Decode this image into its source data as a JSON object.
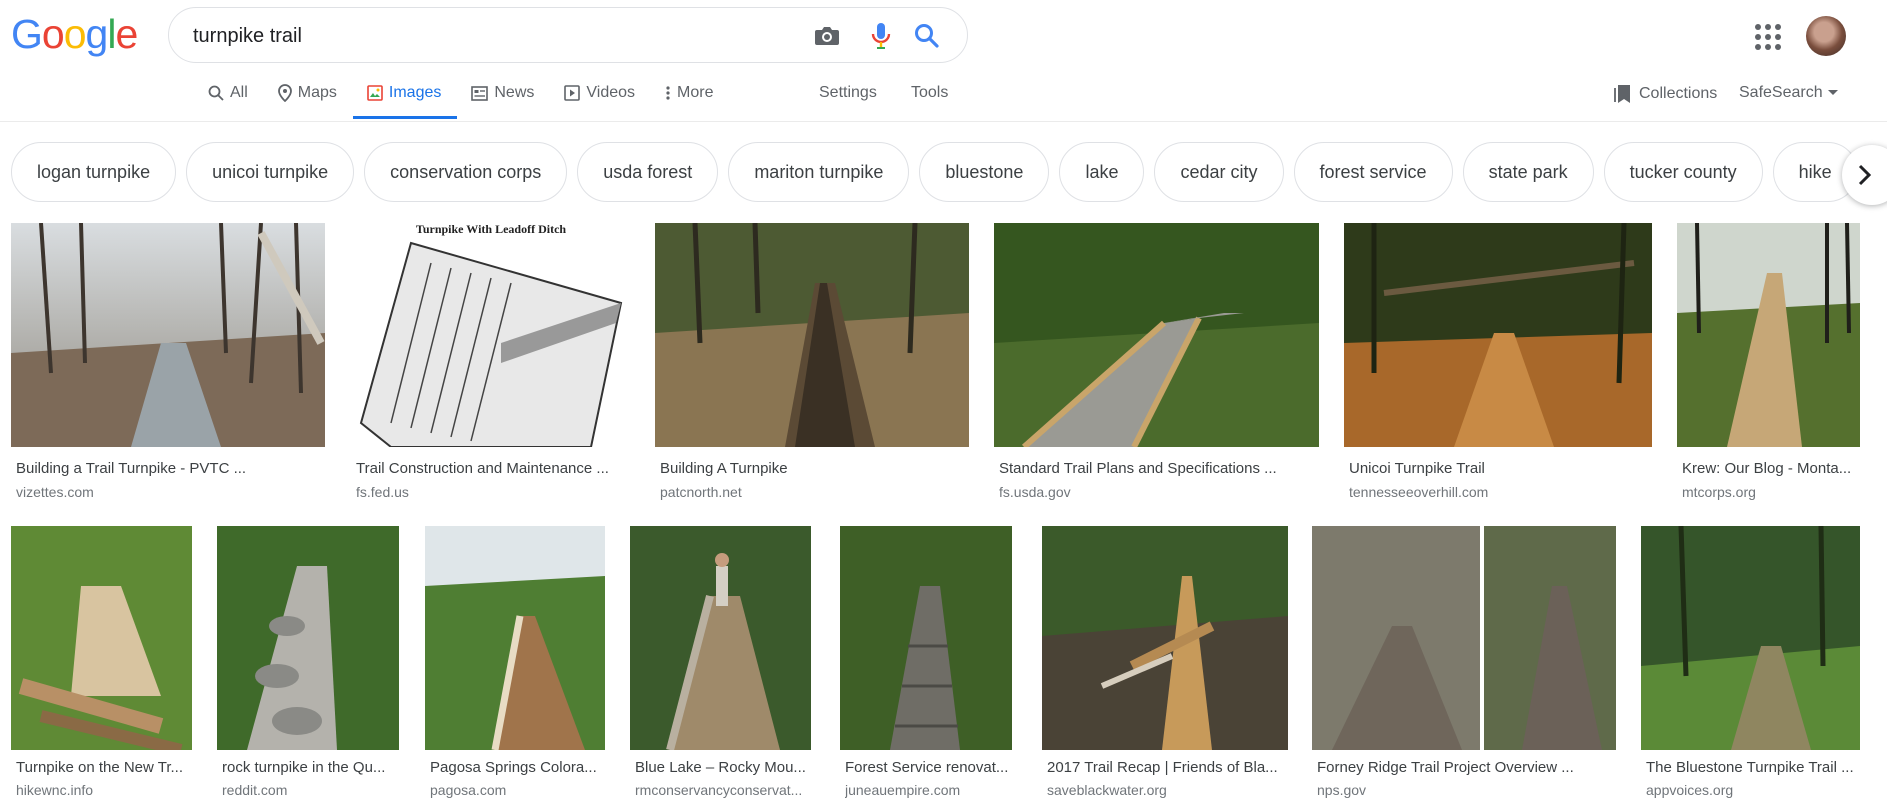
{
  "logo": {
    "letters": [
      "G",
      "o",
      "o",
      "g",
      "l",
      "e"
    ],
    "colors": [
      "#4285f4",
      "#ea4335",
      "#fbbc05",
      "#4285f4",
      "#34a853",
      "#ea4335"
    ]
  },
  "search": {
    "query": "turnpike trail",
    "camera_icon": "camera-icon",
    "mic_icon": "mic-icon",
    "search_icon": "search-icon"
  },
  "header": {
    "apps_icon": "apps-grid-icon",
    "avatar": "account-avatar"
  },
  "tabs": [
    {
      "label": "All",
      "icon": "search-icon"
    },
    {
      "label": "Maps",
      "icon": "map-pin-icon"
    },
    {
      "label": "Images",
      "icon": "images-icon",
      "active": true
    },
    {
      "label": "News",
      "icon": "news-icon"
    },
    {
      "label": "Videos",
      "icon": "video-icon"
    },
    {
      "label": "More",
      "icon": "more-vert-icon"
    }
  ],
  "tools": {
    "settings": "Settings",
    "tools": "Tools"
  },
  "right": {
    "collections": "Collections",
    "safesearch": "SafeSearch"
  },
  "colors": {
    "accent": "#1a73e8",
    "text_secondary": "#5f6368",
    "source": "#70757a",
    "border": "#dfe1e5"
  },
  "chips": [
    "logan turnpike",
    "unicoi turnpike",
    "conservation corps",
    "usda forest",
    "mariton turnpike",
    "bluestone",
    "lake",
    "cedar city",
    "forest service",
    "state park",
    "tucker county",
    "hike"
  ],
  "results": [
    {
      "title": "Building a Trail Turnpike - PVTC ...",
      "source": "vizettes.com"
    },
    {
      "title": "Trail Construction and Maintenance ...",
      "source": "fs.fed.us",
      "image_text": "Turnpike With Leadoff Ditch"
    },
    {
      "title": "Building A Turnpike",
      "source": "patcnorth.net"
    },
    {
      "title": "Standard Trail Plans and Specifications ...",
      "source": "fs.usda.gov"
    },
    {
      "title": "Unicoi Turnpike Trail",
      "source": "tennesseeoverhill.com"
    },
    {
      "title": "Krew: Our Blog - Monta...",
      "source": "mtcorps.org"
    },
    {
      "title": "Turnpike on the New Tr...",
      "source": "hikewnc.info"
    },
    {
      "title": "rock turnpike in the Qu...",
      "source": "reddit.com"
    },
    {
      "title": "Pagosa Springs Colora...",
      "source": "pagosa.com"
    },
    {
      "title": "Blue Lake – Rocky Mou...",
      "source": "rmconservancyconservat..."
    },
    {
      "title": "Forest Service renovat...",
      "source": "juneauempire.com"
    },
    {
      "title": "2017 Trail Recap | Friends of Bla...",
      "source": "saveblackwater.org"
    },
    {
      "title": "Forney Ridge Trail Project Overview ...",
      "source": "nps.gov"
    },
    {
      "title": "The Bluestone Turnpike Trail ...",
      "source": "appvoices.org"
    }
  ]
}
